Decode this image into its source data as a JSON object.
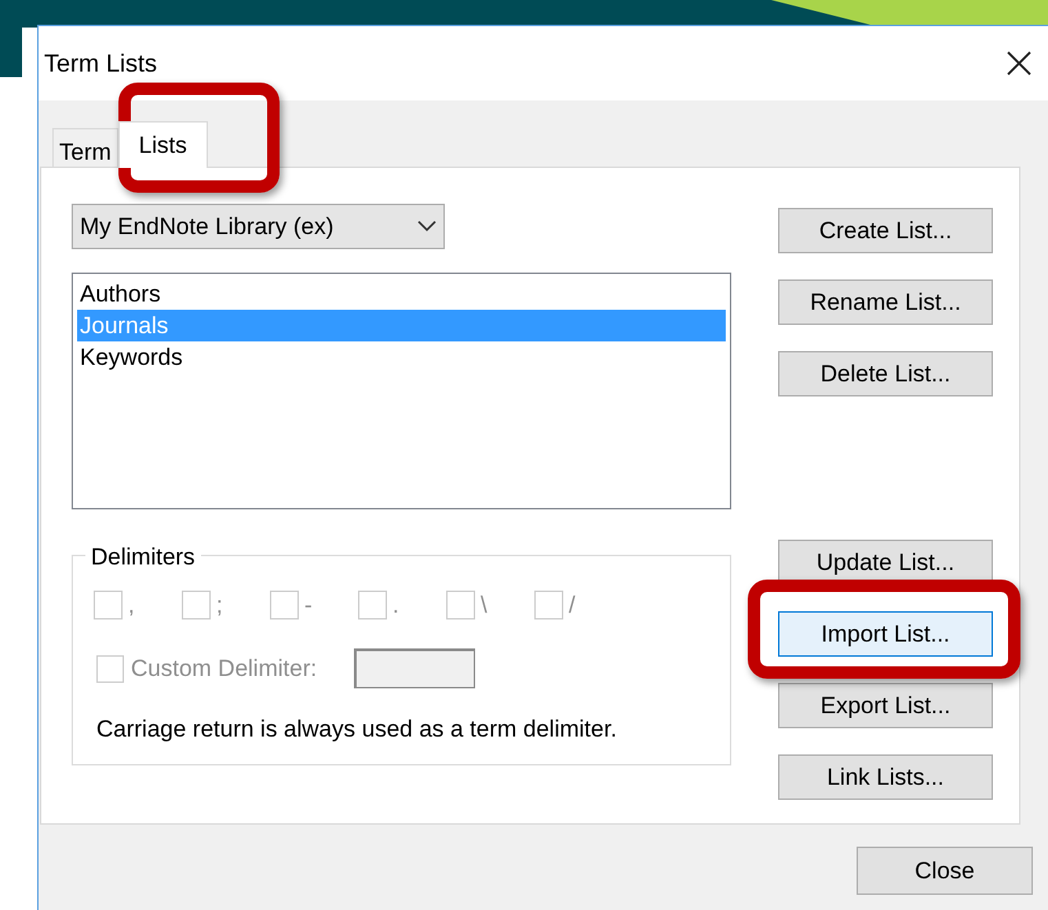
{
  "window": {
    "title": "Term Lists"
  },
  "tabs": [
    {
      "label": "Term",
      "selected": false
    },
    {
      "label": "Lists",
      "selected": true
    }
  ],
  "library_dropdown": {
    "value": "My EndNote Library (ex)"
  },
  "lists": [
    {
      "label": "Authors",
      "selected": false
    },
    {
      "label": "Journals",
      "selected": true
    },
    {
      "label": "Keywords",
      "selected": false
    }
  ],
  "side_buttons": [
    [
      {
        "label": "Create List...",
        "focused": false
      },
      {
        "label": "Rename List...",
        "focused": false
      },
      {
        "label": "Delete List...",
        "focused": false
      }
    ],
    [
      {
        "label": "Update List...",
        "focused": false
      },
      {
        "label": "Import List...",
        "focused": true
      },
      {
        "label": "Export List...",
        "focused": false
      },
      {
        "label": "Link Lists...",
        "focused": false
      }
    ]
  ],
  "delimiters": {
    "title": "Delimiters",
    "disabled": true,
    "options": [
      {
        "label": ",",
        "checked": false
      },
      {
        "label": ";",
        "checked": false
      },
      {
        "label": "-",
        "checked": false
      },
      {
        "label": ".",
        "checked": false
      },
      {
        "label": "\\",
        "checked": false
      },
      {
        "label": "/",
        "checked": false
      }
    ],
    "custom": {
      "label": "Custom Delimiter:",
      "checked": false
    },
    "note": "Carriage return is always used as a term delimiter."
  },
  "close_button": {
    "label": "Close"
  }
}
